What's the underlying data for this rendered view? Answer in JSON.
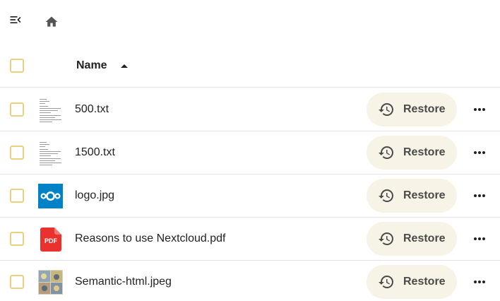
{
  "header": {
    "name_label": "Name"
  },
  "files": [
    {
      "name": "500.txt",
      "thumb": "text-preview",
      "restore_label": "Restore"
    },
    {
      "name": "1500.txt",
      "thumb": "text-preview",
      "restore_label": "Restore"
    },
    {
      "name": "logo.jpg",
      "thumb": "nextcloud-logo",
      "restore_label": "Restore"
    },
    {
      "name": "Reasons to use Nextcloud.pdf",
      "thumb": "pdf-icon",
      "restore_label": "Restore",
      "thumb_text": "PDF"
    },
    {
      "name": "Semantic-html.jpeg",
      "thumb": "comic-preview",
      "restore_label": "Restore"
    }
  ],
  "colors": {
    "checkbox_border": "#e9d27e",
    "restore_bg": "#f7f3e6",
    "nextcloud_blue": "#0082c9",
    "pdf_red": "#e9322d"
  }
}
